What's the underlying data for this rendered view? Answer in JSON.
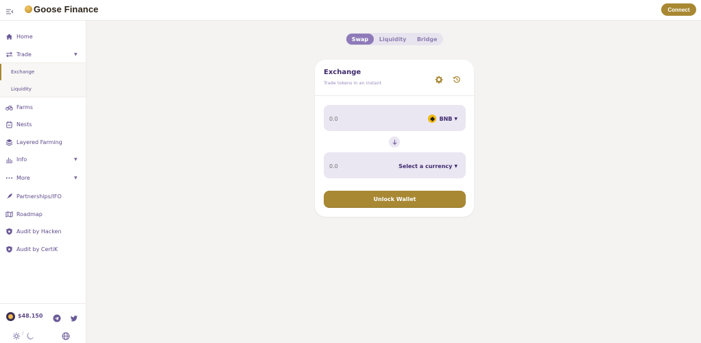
{
  "app": {
    "brand_name": "Goose Finance",
    "connect_label": "Connect",
    "colors": {
      "accent_gold": "#a88833",
      "text_purple": "#452a7a",
      "tab_active": "#8e7ab8",
      "input_bg": "#eae6f2",
      "page_bg": "#f4f3f1"
    }
  },
  "sidebar": {
    "items": [
      {
        "label": "Home",
        "icon": "home-icon"
      },
      {
        "label": "Trade",
        "icon": "trade-icon",
        "expandable": true,
        "expanded": true
      },
      {
        "label": "Farms",
        "icon": "farms-icon"
      },
      {
        "label": "Nests",
        "icon": "nests-icon"
      },
      {
        "label": "Layered Farming",
        "icon": "layers-icon"
      },
      {
        "label": "Info",
        "icon": "info-chart-icon",
        "expandable": true
      },
      {
        "label": "More",
        "icon": "more-icon",
        "expandable": true
      },
      {
        "label": "Partnerships/IFO",
        "icon": "partnerships-icon"
      },
      {
        "label": "Roadmap",
        "icon": "roadmap-icon"
      },
      {
        "label": "Audit by Hacken",
        "icon": "shield-icon"
      },
      {
        "label": "Audit by CertiK",
        "icon": "shield-icon"
      }
    ],
    "trade_sub": [
      {
        "label": "Exchange",
        "active": true
      },
      {
        "label": "Liquidity",
        "active": false
      }
    ],
    "footer": {
      "price": "$48.150",
      "theme_separator": "/",
      "icons": [
        "egg-coin-icon",
        "telegram-icon",
        "twitter-icon",
        "sun-icon",
        "moon-icon",
        "globe-icon"
      ]
    }
  },
  "main": {
    "tabs": [
      {
        "label": "Swap",
        "active": true
      },
      {
        "label": "Liquidity",
        "active": false
      },
      {
        "label": "Bridge",
        "active": false
      }
    ],
    "card": {
      "title": "Exchange",
      "subtitle": "Trade tokens in an instant",
      "from": {
        "placeholder": "0.0",
        "currency": "BNB"
      },
      "to": {
        "placeholder": "0.0",
        "currency": "Select a currency"
      },
      "unlock_label": "Unlock Wallet"
    }
  }
}
